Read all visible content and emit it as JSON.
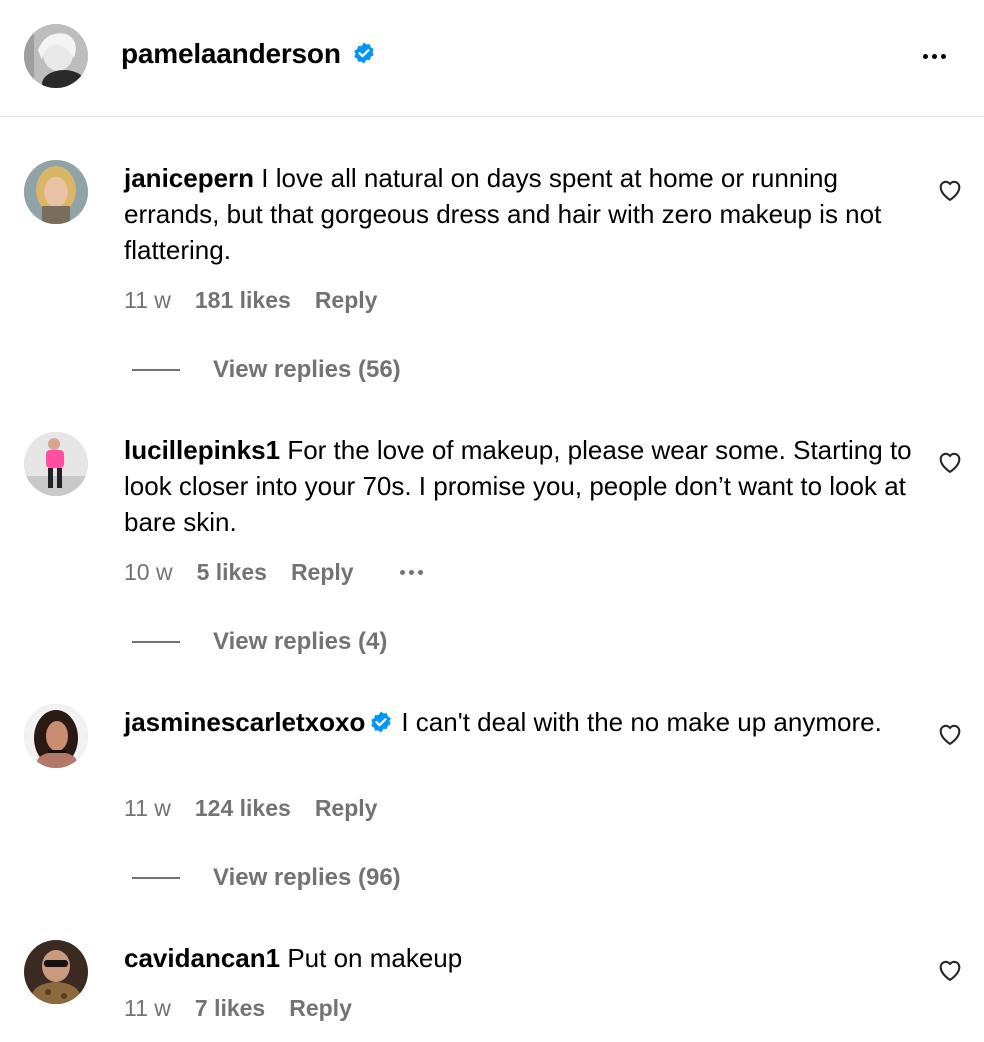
{
  "post": {
    "owner": "pamelaanderson",
    "owner_verified": true,
    "more_icon": "more-horizontal-icon"
  },
  "colors": {
    "verified_blue": "#0095f6",
    "secondary_text": "#737373",
    "divider": "#e6e6e6"
  },
  "comments": [
    {
      "username": "janicepern",
      "verified": false,
      "text": "I love all natural on days spent at home or running errands, but that gorgeous dress and hair with zero makeup is not flattering.",
      "time": "11 w",
      "likes": "181 likes",
      "reply_label": "Reply",
      "view_replies": "View replies (56)",
      "like_icon": "heart-outline-icon"
    },
    {
      "username": "lucillepinks1",
      "verified": false,
      "text": "For the love of makeup, please wear some. Starting to look closer into your 70s. I promise you, people don’t want to look at bare skin.",
      "time": "10 w",
      "likes": "5 likes",
      "reply_label": "Reply",
      "has_options": true,
      "view_replies": "View replies (4)",
      "like_icon": "heart-outline-icon"
    },
    {
      "username": "jasminescarletxoxo",
      "verified": true,
      "text": "I can't deal with the no make up anymore.",
      "time": "11 w",
      "likes": "124 likes",
      "reply_label": "Reply",
      "view_replies": "View replies (96)",
      "like_icon": "heart-outline-icon"
    },
    {
      "username": "cavidancan1",
      "verified": false,
      "text": "Put on makeup",
      "time": "11 w",
      "likes": "7 likes",
      "reply_label": "Reply",
      "like_icon": "heart-outline-icon"
    }
  ]
}
